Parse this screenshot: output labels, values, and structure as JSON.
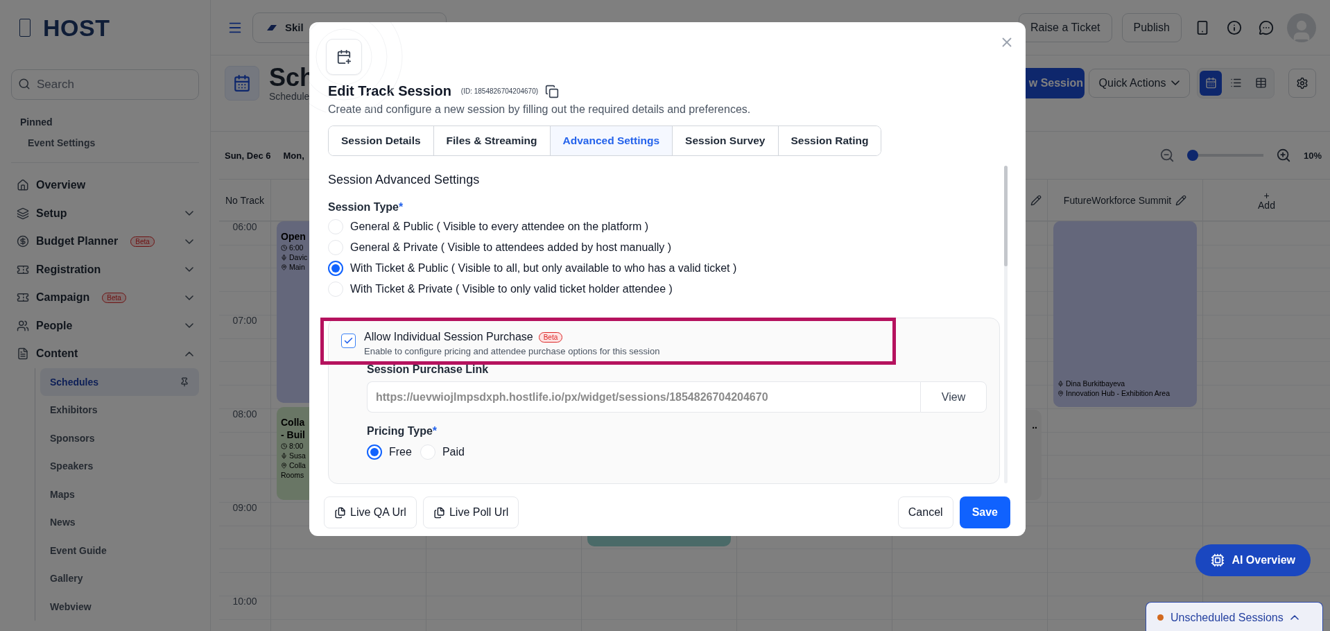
{
  "sidebar": {
    "logo": "HOST",
    "search": {
      "placeholder": "Search"
    },
    "pinned": {
      "title": "Pinned",
      "items": [
        "Event Settings"
      ]
    },
    "nav": [
      {
        "label": "Overview"
      },
      {
        "label": "Setup",
        "expanded": false
      },
      {
        "label": "Budget Planner",
        "badge": "Beta",
        "expanded": false
      },
      {
        "label": "Registration",
        "expanded": false
      },
      {
        "label": "Campaign",
        "badge": "Beta",
        "expanded": false
      },
      {
        "label": "People",
        "expanded": false
      },
      {
        "label": "Content",
        "expanded": true,
        "children": [
          {
            "label": "Schedules",
            "selected": true,
            "pinned": true
          },
          {
            "label": "Exhibitors",
            "selected": false
          },
          {
            "label": "Sponsors",
            "selected": false
          },
          {
            "label": "Speakers",
            "selected": false
          },
          {
            "label": "Maps",
            "selected": false
          },
          {
            "label": "News",
            "selected": false
          },
          {
            "label": "Event Guide",
            "selected": false
          },
          {
            "label": "Gallery",
            "selected": false
          },
          {
            "label": "Webview",
            "selected": false
          }
        ]
      }
    ]
  },
  "topbar": {
    "event": "Skil",
    "buttons": [
      "Raise a Ticket",
      "Publish"
    ]
  },
  "header": {
    "title": "Sch",
    "subtitle": "Schedule",
    "new_button": "w Session",
    "quick_actions": "Quick Actions",
    "views": [
      {
        "selected": true
      },
      {
        "selected": false
      },
      {
        "selected": false
      }
    ]
  },
  "calendar": {
    "days": [
      "Sun, Dec 6",
      "Mon,"
    ],
    "zoom": {
      "level": 0,
      "reading": "10%"
    },
    "time_header": "No Track",
    "times": [
      "06:00",
      "07:00",
      "08:00",
      "09:00",
      "10:00"
    ],
    "columns": [
      {
        "kind": "track",
        "sessions": [
          {
            "title_lines": [
              "Open"
            ],
            "time": "6:00",
            "speaker": "Davic",
            "location_lines": [
              "Main"
            ],
            "color": "#64677b"
          },
          {
            "title_lines": [
              "Colla",
              "- Buil"
            ],
            "time": "8:00",
            "speaker": "Susa",
            "location_lines": [
              "Colla",
              "Rooms"
            ],
            "color": "#697665"
          }
        ]
      },
      {
        "kind": "track"
      },
      {
        "kind": "track",
        "sessions": [
          {
            "color": "#4a6a68"
          }
        ]
      },
      {
        "kind": "track"
      },
      {
        "kind": "track",
        "editable": true,
        "sessions": [
          {
            "title_lines": [
              ".."
            ],
            "color": "#797979"
          }
        ]
      },
      {
        "kind": "track",
        "name": "FutureWorkforce Summit",
        "editable": true,
        "sessions": [
          {
            "speaker": "Dina Burkitbayeva",
            "location_lines": [
              "Innovation Hub - Exhibition Area"
            ],
            "color": "#64677b"
          }
        ]
      },
      {
        "kind": "add",
        "label": "Add",
        "icon": "+"
      }
    ]
  },
  "ai_button": "AI Overview",
  "unscheduled": {
    "label": "Unscheduled Sessions",
    "expanded": false
  },
  "modal": {
    "title": "Edit Track Session",
    "id_label": "(ID: 1854826704204670)",
    "subtitle": "Create and configure a new session by filling out the required details and preferences.",
    "tabs": [
      {
        "label": "Session Details",
        "selected": false
      },
      {
        "label": "Files & Streaming",
        "selected": false
      },
      {
        "label": "Advanced Settings",
        "selected": true
      },
      {
        "label": "Session Survey",
        "selected": false
      },
      {
        "label": "Session Rating",
        "selected": false
      }
    ],
    "section_title": "Session Advanced Settings",
    "session_type": {
      "label": "Session Type",
      "required_mark": "*",
      "options": [
        {
          "label": "General & Public ( Visible to every attendee on the platform )",
          "selected": false
        },
        {
          "label": "General & Private ( Visible to attendees added by host manually )",
          "selected": false
        },
        {
          "label": "With Ticket & Public ( Visible to all, but only available to who has a valid ticket )",
          "selected": true
        },
        {
          "label": "With Ticket & Private ( Visible to only valid ticket holder attendee )",
          "selected": false
        }
      ]
    },
    "purchase": {
      "checked": true,
      "label": "Allow Individual Session Purchase",
      "badge": "Beta",
      "description": "Enable to configure pricing and attendee purchase options for this session",
      "link_label": "Session Purchase Link",
      "link_value": "https://uevwiojlmpsdxph.hostlife.io/px/widget/sessions/1854826704204670",
      "view_button": "View",
      "pricing": {
        "label": "Pricing Type",
        "required_mark": "*",
        "options": [
          {
            "label": "Free",
            "selected": true
          },
          {
            "label": "Paid",
            "selected": false
          }
        ]
      }
    },
    "footer": {
      "link_buttons": [
        "Live QA Url",
        "Live Poll Url"
      ],
      "cancel": "Cancel",
      "save": "Save"
    }
  }
}
